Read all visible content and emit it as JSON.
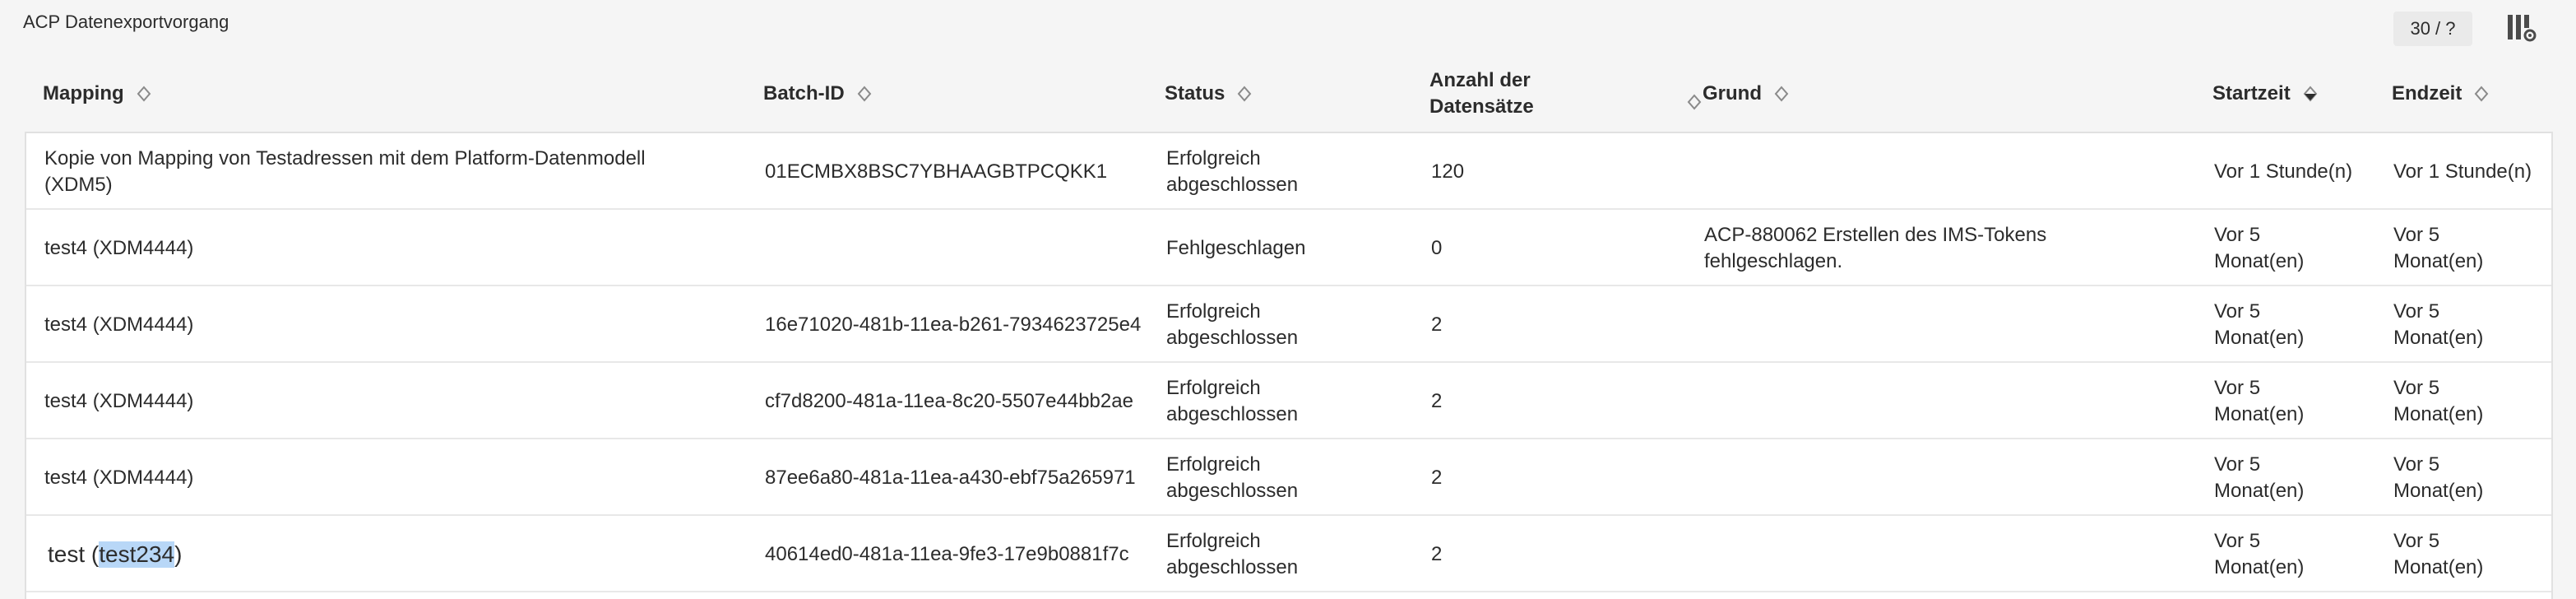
{
  "app_title": "ACP Datenexportvorgang",
  "pagination": {
    "counter": "30 / ?"
  },
  "icons": {
    "column_settings": "column-settings-icon",
    "sort": "sort-arrows-icon"
  },
  "colors": {
    "highlight": "#b8d7f7",
    "header_bg": "#f5f5f5",
    "row_bg": "#ffffff"
  },
  "columns": [
    {
      "label": "Mapping"
    },
    {
      "label": "Batch-ID"
    },
    {
      "label": "Status"
    },
    {
      "label_line1": "Anzahl der",
      "label_line2": "Datensätze"
    },
    {
      "label": "Grund"
    },
    {
      "label": "Startzeit"
    },
    {
      "label": "Endzeit"
    }
  ],
  "rows": [
    {
      "mapping_line1": "Kopie von Mapping von Testadressen mit dem Platform-Datenmodell",
      "mapping_line2": "(XDM5)",
      "batch_id": "01ECMBX8BSC7YBHAAGBTPCQKK1",
      "status_line1": "Erfolgreich",
      "status_line2": "abgeschlossen",
      "count": "120",
      "reason_line1": "",
      "reason_line2": "",
      "start_line1": "Vor 1 Stunde(n)",
      "start_line2": "",
      "end_line1": "Vor 1 Stunde(n)",
      "end_line2": ""
    },
    {
      "mapping_line1": "test4 (XDM4444)",
      "batch_id": "",
      "status_line1": "Fehlgeschlagen",
      "status_line2": "",
      "count": "0",
      "reason_line1": "ACP-880062 Erstellen des IMS-Tokens",
      "reason_line2": "fehlgeschlagen.",
      "start_line1": "Vor 5",
      "start_line2": "Monat(en)",
      "end_line1": "Vor 5",
      "end_line2": "Monat(en)"
    },
    {
      "mapping_line1": "test4 (XDM4444)",
      "batch_id": "16e71020-481b-11ea-b261-7934623725e4",
      "status_line1": "Erfolgreich",
      "status_line2": "abgeschlossen",
      "count": "2",
      "reason_line1": "",
      "reason_line2": "",
      "start_line1": "Vor 5",
      "start_line2": "Monat(en)",
      "end_line1": "Vor 5",
      "end_line2": "Monat(en)"
    },
    {
      "mapping_line1": "test4 (XDM4444)",
      "batch_id": "cf7d8200-481a-11ea-8c20-5507e44bb2ae",
      "status_line1": "Erfolgreich",
      "status_line2": "abgeschlossen",
      "count": "2",
      "reason_line1": "",
      "reason_line2": "",
      "start_line1": "Vor 5",
      "start_line2": "Monat(en)",
      "end_line1": "Vor 5",
      "end_line2": "Monat(en)"
    },
    {
      "mapping_line1": "test4 (XDM4444)",
      "batch_id": "87ee6a80-481a-11ea-a430-ebf75a265971",
      "status_line1": "Erfolgreich",
      "status_line2": "abgeschlossen",
      "count": "2",
      "reason_line1": "",
      "reason_line2": "",
      "start_line1": "Vor 5",
      "start_line2": "Monat(en)",
      "end_line1": "Vor 5",
      "end_line2": "Monat(en)"
    },
    {
      "mapping_prefix": "test (",
      "mapping_highlight": "test234",
      "mapping_suffix": ")",
      "batch_id": "40614ed0-481a-11ea-9fe3-17e9b0881f7c",
      "status_line1": "Erfolgreich",
      "status_line2": "abgeschlossen",
      "count": "2",
      "reason_line1": "",
      "reason_line2": "",
      "start_line1": "Vor 5",
      "start_line2": "Monat(en)",
      "end_line1": "Vor 5",
      "end_line2": "Monat(en)"
    }
  ]
}
